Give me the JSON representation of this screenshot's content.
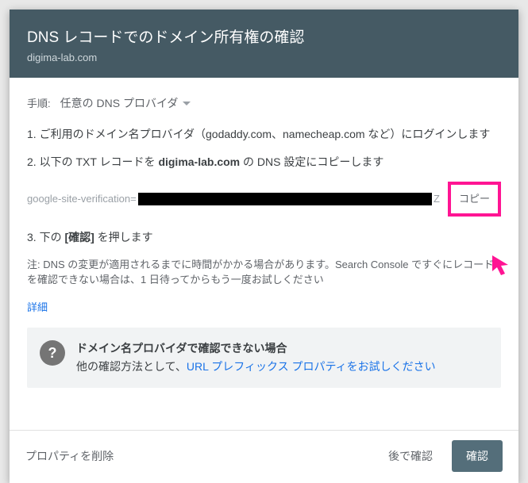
{
  "header": {
    "title": "DNS レコードでのドメイン所有権の確認",
    "subtitle": "digima-lab.com"
  },
  "steps": {
    "label": "手順:",
    "provider": "任意の DNS プロバイダ"
  },
  "step1": "1. ご利用のドメイン名プロバイダ（godaddy.com、namecheap.com など）にログインします",
  "step2_prefix": "2. 以下の TXT レコードを ",
  "step2_domain": "digima-lab.com",
  "step2_suffix": " の DNS 設定にコピーします",
  "txt_record": {
    "prefix": "google-site-verification=",
    "suffix": "Z"
  },
  "copy_label": "コピー",
  "step3_prefix": "3. 下の ",
  "step3_bold": "[確認]",
  "step3_suffix": " を押します",
  "note": "注: DNS の変更が適用されるまでに時間がかかる場合があります。Search Console ですぐにレコードを確認できない場合は、1 日待ってからもう一度お試しください",
  "details_link": "詳細",
  "info": {
    "title": "ドメイン名プロバイダで確認できない場合",
    "desc_prefix": "他の確認方法として、",
    "link": "URL プレフィックス プロパティをお試しください"
  },
  "footer": {
    "delete": "プロパティを削除",
    "later": "後で確認",
    "confirm": "確認"
  }
}
